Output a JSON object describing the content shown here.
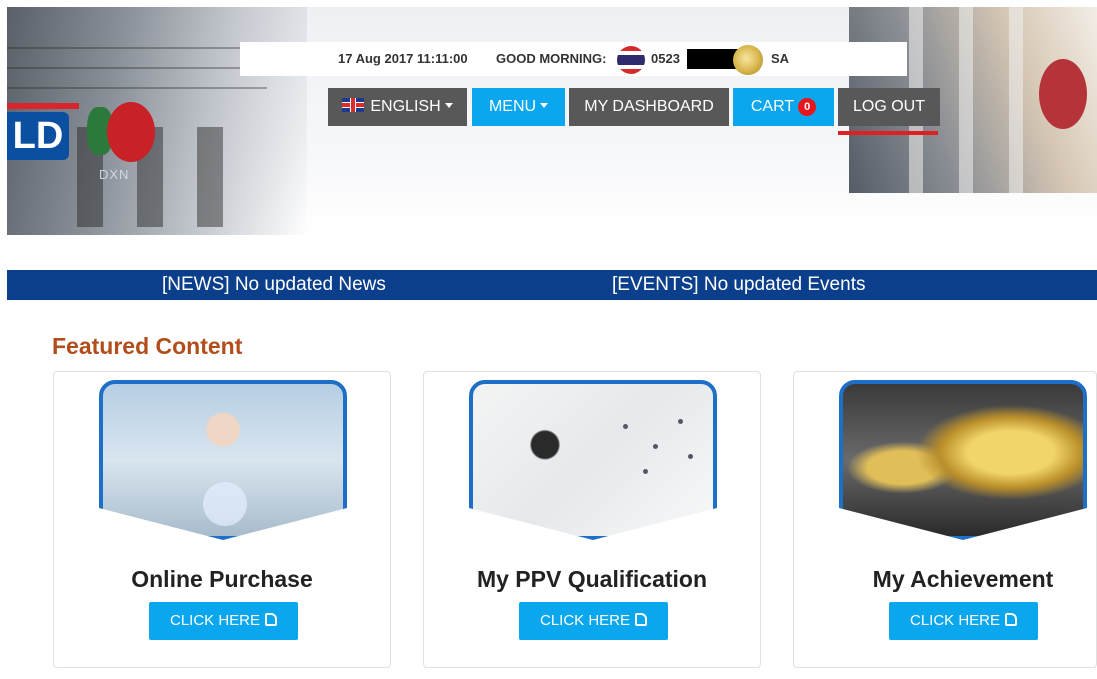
{
  "infobar": {
    "datetime": "17 Aug 2017  11:11:00",
    "greeting": "GOOD MORNING:",
    "member_prefix": "0523",
    "country": "SA"
  },
  "nav": {
    "language": "ENGLISH",
    "menu": "MENU",
    "dashboard": "MY DASHBOARD",
    "cart": "CART",
    "cart_count": "0",
    "logout": "LOG OUT"
  },
  "banner": {
    "logo_text": "LD",
    "sign_text": "DXN"
  },
  "ticker": {
    "news": "[NEWS] No updated News",
    "events": "[EVENTS] No updated Events"
  },
  "featured": {
    "heading": "Featured Content",
    "cards": [
      {
        "title": "Online Purchase",
        "button": "CLICK HERE"
      },
      {
        "title": "My PPV Qualification",
        "button": "CLICK HERE"
      },
      {
        "title": "My Achievement",
        "button": "CLICK HERE"
      }
    ]
  },
  "colors": {
    "accent_blue": "#0aa6ee",
    "nav_gray": "#585858",
    "ticker_navy": "#0b3f8c",
    "heading_orange": "#b24e1b",
    "badge_red": "#e8161b"
  },
  "icons": [
    "uk-flag-icon",
    "thai-flag-icon",
    "medal-icon",
    "caret-down-icon",
    "thumbs-up-icon"
  ]
}
